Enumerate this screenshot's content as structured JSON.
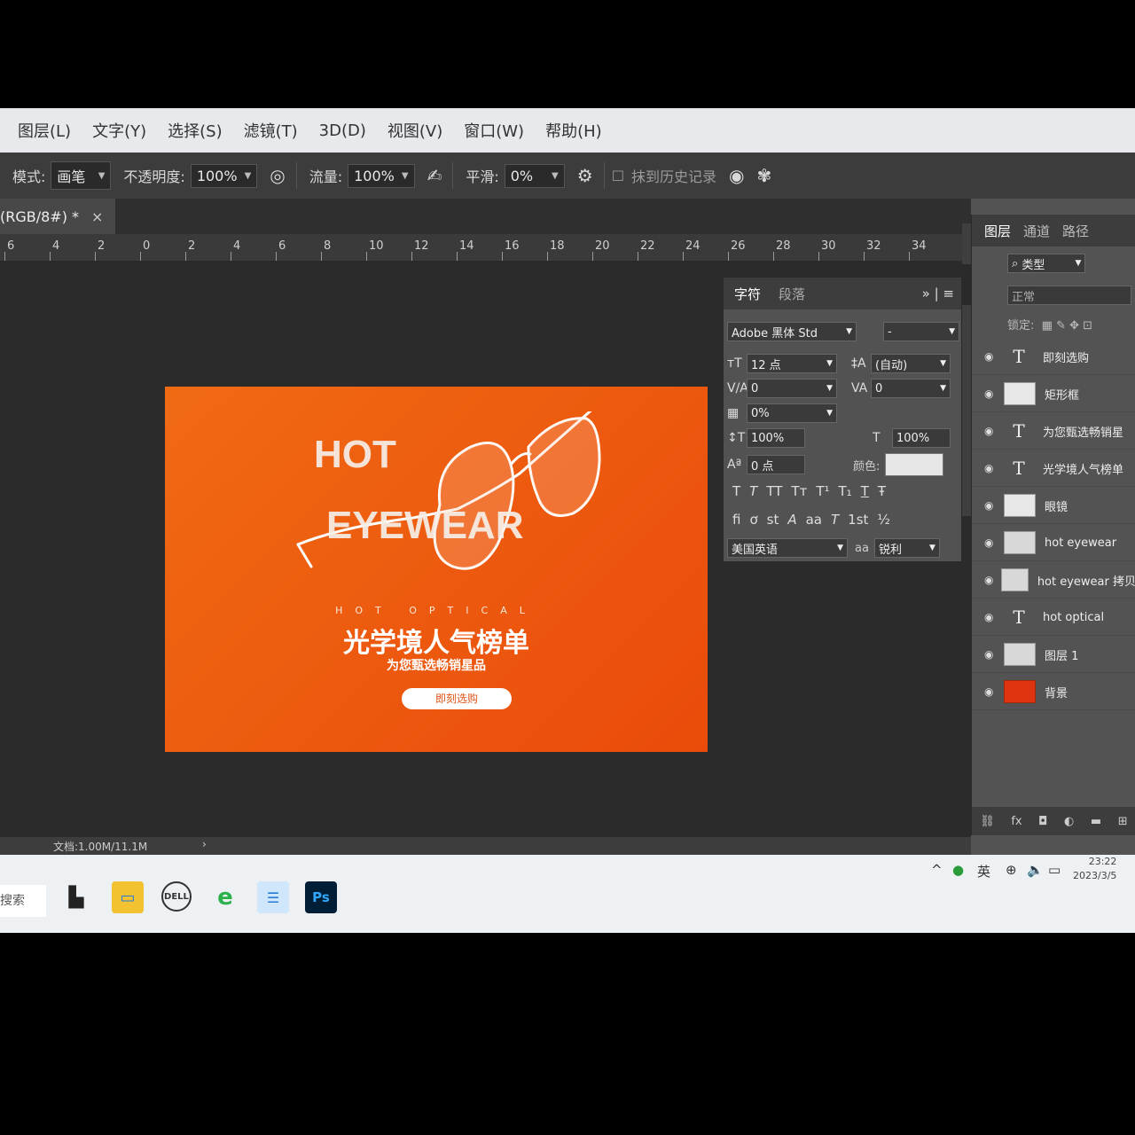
{
  "menu": [
    "图层(L)",
    "文字(Y)",
    "选择(S)",
    "滤镜(T)",
    "3D(D)",
    "视图(V)",
    "窗口(W)",
    "帮助(H)"
  ],
  "options": {
    "mode_label": "模式:",
    "mode_value": "画笔",
    "opacity_label": "不透明度:",
    "opacity_value": "100%",
    "flow_label": "流量:",
    "flow_value": "100%",
    "smooth_label": "平滑:",
    "smooth_value": "0%",
    "history_label": "抹到历史记录"
  },
  "doc_tab": {
    "title": "(RGB/8#) *",
    "close": "×"
  },
  "ruler": [
    "6",
    "4",
    "2",
    "0",
    "2",
    "4",
    "6",
    "8",
    "10",
    "12",
    "14",
    "16",
    "18",
    "20",
    "22",
    "24",
    "26",
    "28",
    "30",
    "32",
    "34"
  ],
  "artwork": {
    "hot": "HOT",
    "eyewear": "EYEWEAR",
    "optical": "HOT OPTICAL",
    "headline": "光学境人气榜单",
    "subline": "为您甄选畅销星品",
    "button": "即刻选购"
  },
  "character_panel": {
    "tab_char": "字符",
    "tab_para": "段落",
    "font_family": "Adobe 黑体 Std",
    "font_style": "-",
    "size": "12 点",
    "leading": "(自动)",
    "kerning": "0",
    "tracking": "0",
    "scale_pct": "0%",
    "vscale": "100%",
    "hscale": "100%",
    "baseline": "0 点",
    "color_label": "颜色:",
    "language": "美国英语",
    "aa_label": "aa",
    "antialias": "锐利",
    "styles": [
      "T",
      "T",
      "TT",
      "Tт",
      "T¹",
      "T₁",
      "T",
      "Ŧ"
    ],
    "opentype": [
      "fi",
      "ơ",
      "st",
      "A",
      "aa",
      "T",
      "1st",
      "½"
    ]
  },
  "layers_panel": {
    "tabs": [
      "图层",
      "通道",
      "路径"
    ],
    "filter": "类型",
    "blend": "正常",
    "lock_label": "锁定:",
    "items": [
      {
        "name": "即刻选购",
        "kind": "text"
      },
      {
        "name": "矩形框",
        "kind": "smart"
      },
      {
        "name": "为您甄选畅销星",
        "kind": "text"
      },
      {
        "name": "光学境人气榜单",
        "kind": "text"
      },
      {
        "name": "眼镜",
        "kind": "smart"
      },
      {
        "name": "hot eyewear",
        "kind": "pixel"
      },
      {
        "name": "hot eyewear 拷贝",
        "kind": "pixel"
      },
      {
        "name": "hot optical",
        "kind": "text"
      },
      {
        "name": "图层 1",
        "kind": "pixel"
      },
      {
        "name": "背景",
        "kind": "fill"
      }
    ],
    "bottom_icons": [
      "link-icon",
      "fx-icon",
      "mask-icon",
      "adjust-icon",
      "folder-icon",
      "new-layer-icon"
    ]
  },
  "status": {
    "doc": "文档:1.00M/11.1M",
    "arrow": "›"
  },
  "taskbar": {
    "search": "搜索",
    "ime": "英",
    "time": "23:22",
    "date": "2023/3/5",
    "ps_label": "Ps",
    "dell_label": "DELL"
  },
  "colors": {
    "orange": "#ee5a10",
    "ps_blue": "#31a8ff",
    "layer_bg_red": "#e03410"
  }
}
